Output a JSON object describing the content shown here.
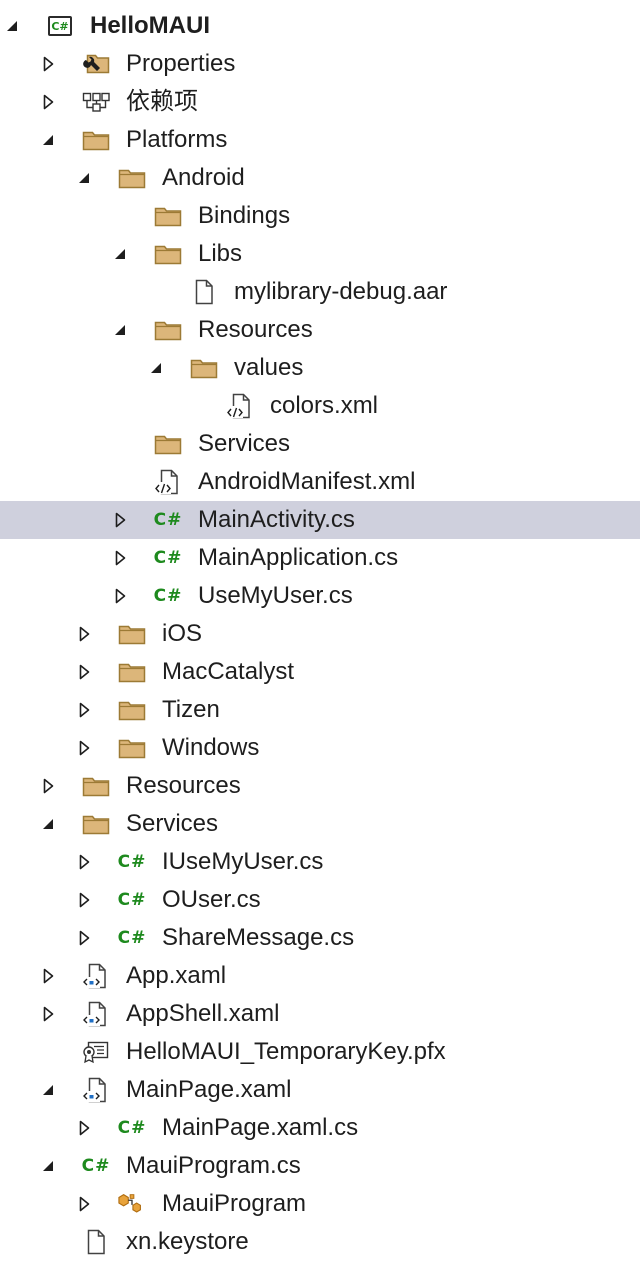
{
  "tree": {
    "rows": [
      {
        "label": "HelloMAUI",
        "depth": 0,
        "icon": "csharp-project-icon",
        "expander": "expanded",
        "bold": true
      },
      {
        "label": "Properties",
        "depth": 1,
        "icon": "properties-folder-icon",
        "expander": "collapsed"
      },
      {
        "label": "依赖项",
        "depth": 1,
        "icon": "dependencies-icon",
        "expander": "collapsed"
      },
      {
        "label": "Platforms",
        "depth": 1,
        "icon": "folder-icon",
        "expander": "expanded"
      },
      {
        "label": "Android",
        "depth": 2,
        "icon": "folder-icon",
        "expander": "expanded"
      },
      {
        "label": "Bindings",
        "depth": 3,
        "icon": "folder-icon",
        "expander": "none"
      },
      {
        "label": "Libs",
        "depth": 3,
        "icon": "folder-icon",
        "expander": "expanded"
      },
      {
        "label": "mylibrary-debug.aar",
        "depth": 4,
        "icon": "file-icon",
        "expander": "none"
      },
      {
        "label": "Resources",
        "depth": 3,
        "icon": "folder-icon",
        "expander": "expanded"
      },
      {
        "label": "values",
        "depth": 4,
        "icon": "folder-icon",
        "expander": "expanded"
      },
      {
        "label": "colors.xml",
        "depth": 5,
        "icon": "xml-file-icon",
        "expander": "none"
      },
      {
        "label": "Services",
        "depth": 3,
        "icon": "folder-icon",
        "expander": "none"
      },
      {
        "label": "AndroidManifest.xml",
        "depth": 3,
        "icon": "xml-file-icon",
        "expander": "none"
      },
      {
        "label": "MainActivity.cs",
        "depth": 3,
        "icon": "csharp-file-icon",
        "expander": "collapsed",
        "selected": true
      },
      {
        "label": "MainApplication.cs",
        "depth": 3,
        "icon": "csharp-file-icon",
        "expander": "collapsed"
      },
      {
        "label": "UseMyUser.cs",
        "depth": 3,
        "icon": "csharp-file-icon",
        "expander": "collapsed"
      },
      {
        "label": "iOS",
        "depth": 2,
        "icon": "folder-icon",
        "expander": "collapsed"
      },
      {
        "label": "MacCatalyst",
        "depth": 2,
        "icon": "folder-icon",
        "expander": "collapsed"
      },
      {
        "label": "Tizen",
        "depth": 2,
        "icon": "folder-icon",
        "expander": "collapsed"
      },
      {
        "label": "Windows",
        "depth": 2,
        "icon": "folder-icon",
        "expander": "collapsed"
      },
      {
        "label": "Resources",
        "depth": 1,
        "icon": "folder-icon",
        "expander": "collapsed"
      },
      {
        "label": "Services",
        "depth": 1,
        "icon": "folder-icon",
        "expander": "expanded"
      },
      {
        "label": "IUseMyUser.cs",
        "depth": 2,
        "icon": "csharp-file-icon",
        "expander": "collapsed"
      },
      {
        "label": "OUser.cs",
        "depth": 2,
        "icon": "csharp-file-icon",
        "expander": "collapsed"
      },
      {
        "label": "ShareMessage.cs",
        "depth": 2,
        "icon": "csharp-file-icon",
        "expander": "collapsed"
      },
      {
        "label": "App.xaml",
        "depth": 1,
        "icon": "xaml-file-icon",
        "expander": "collapsed"
      },
      {
        "label": "AppShell.xaml",
        "depth": 1,
        "icon": "xaml-file-icon",
        "expander": "collapsed"
      },
      {
        "label": "HelloMAUI_TemporaryKey.pfx",
        "depth": 1,
        "icon": "certificate-icon",
        "expander": "none"
      },
      {
        "label": "MainPage.xaml",
        "depth": 1,
        "icon": "xaml-file-icon",
        "expander": "expanded"
      },
      {
        "label": "MainPage.xaml.cs",
        "depth": 2,
        "icon": "csharp-file-icon",
        "expander": "collapsed"
      },
      {
        "label": "MauiProgram.cs",
        "depth": 1,
        "icon": "csharp-file-icon",
        "expander": "expanded"
      },
      {
        "label": "MauiProgram",
        "depth": 2,
        "icon": "class-icon",
        "expander": "collapsed"
      },
      {
        "label": "xn.keystore",
        "depth": 1,
        "icon": "file-icon",
        "expander": "none"
      }
    ]
  }
}
